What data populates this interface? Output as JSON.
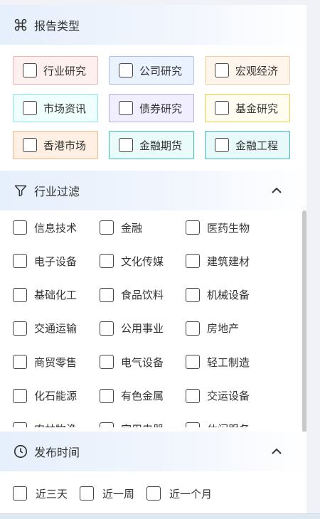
{
  "report_type": {
    "title": "报告类型",
    "tags": [
      {
        "label": "行业研究",
        "bg": "#fff0f0",
        "border": "#f3b3b3"
      },
      {
        "label": "公司研究",
        "bg": "#eaf1ff",
        "border": "#a9c2f0"
      },
      {
        "label": "宏观经济",
        "bg": "#fff5ea",
        "border": "#f1d0a8"
      },
      {
        "label": "市场资讯",
        "bg": "#effffd",
        "border": "#8fe6e0"
      },
      {
        "label": "债券研究",
        "bg": "#f1eeff",
        "border": "#b7aee8"
      },
      {
        "label": "基金研究",
        "bg": "#fffdf0",
        "border": "#e8cf4a"
      },
      {
        "label": "香港市场",
        "bg": "#fff0e3",
        "border": "#efb98c"
      },
      {
        "label": "金融期货",
        "bg": "#eafcfa",
        "border": "#3cbdb5"
      },
      {
        "label": "金融工程",
        "bg": "#e8f9fb",
        "border": "#3fb3bf"
      }
    ]
  },
  "industry": {
    "title": "行业过滤",
    "items": [
      "信息技术",
      "金融",
      "医药生物",
      "电子设备",
      "文化传媒",
      "建筑建材",
      "基础化工",
      "食品饮料",
      "机械设备",
      "交通运输",
      "公用事业",
      "房地产",
      "商贸零售",
      "电气设备",
      "轻工制造",
      "化石能源",
      "有色金属",
      "交运设备",
      "农林牧渔",
      "家用电器",
      "休闲服务"
    ]
  },
  "publish_time": {
    "title": "发布时间",
    "options": [
      "近三天",
      "近一周",
      "近一个月"
    ]
  },
  "colors": {
    "accent": "#e6effc"
  }
}
